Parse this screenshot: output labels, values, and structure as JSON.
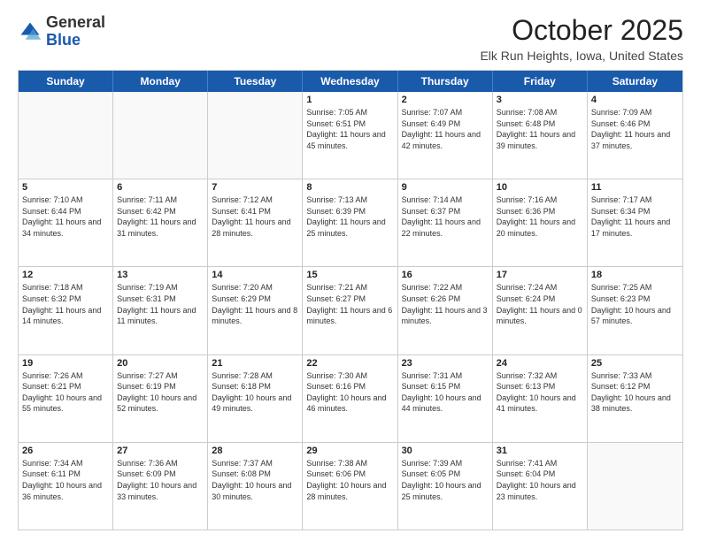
{
  "header": {
    "logo_general": "General",
    "logo_blue": "Blue",
    "month_title": "October 2025",
    "location": "Elk Run Heights, Iowa, United States"
  },
  "days_of_week": [
    "Sunday",
    "Monday",
    "Tuesday",
    "Wednesday",
    "Thursday",
    "Friday",
    "Saturday"
  ],
  "weeks": [
    [
      {
        "day": "",
        "sunrise": "",
        "sunset": "",
        "daylight": "",
        "empty": true
      },
      {
        "day": "",
        "sunrise": "",
        "sunset": "",
        "daylight": "",
        "empty": true
      },
      {
        "day": "",
        "sunrise": "",
        "sunset": "",
        "daylight": "",
        "empty": true
      },
      {
        "day": "1",
        "sunrise": "Sunrise: 7:05 AM",
        "sunset": "Sunset: 6:51 PM",
        "daylight": "Daylight: 11 hours and 45 minutes.",
        "empty": false
      },
      {
        "day": "2",
        "sunrise": "Sunrise: 7:07 AM",
        "sunset": "Sunset: 6:49 PM",
        "daylight": "Daylight: 11 hours and 42 minutes.",
        "empty": false
      },
      {
        "day": "3",
        "sunrise": "Sunrise: 7:08 AM",
        "sunset": "Sunset: 6:48 PM",
        "daylight": "Daylight: 11 hours and 39 minutes.",
        "empty": false
      },
      {
        "day": "4",
        "sunrise": "Sunrise: 7:09 AM",
        "sunset": "Sunset: 6:46 PM",
        "daylight": "Daylight: 11 hours and 37 minutes.",
        "empty": false
      }
    ],
    [
      {
        "day": "5",
        "sunrise": "Sunrise: 7:10 AM",
        "sunset": "Sunset: 6:44 PM",
        "daylight": "Daylight: 11 hours and 34 minutes.",
        "empty": false
      },
      {
        "day": "6",
        "sunrise": "Sunrise: 7:11 AM",
        "sunset": "Sunset: 6:42 PM",
        "daylight": "Daylight: 11 hours and 31 minutes.",
        "empty": false
      },
      {
        "day": "7",
        "sunrise": "Sunrise: 7:12 AM",
        "sunset": "Sunset: 6:41 PM",
        "daylight": "Daylight: 11 hours and 28 minutes.",
        "empty": false
      },
      {
        "day": "8",
        "sunrise": "Sunrise: 7:13 AM",
        "sunset": "Sunset: 6:39 PM",
        "daylight": "Daylight: 11 hours and 25 minutes.",
        "empty": false
      },
      {
        "day": "9",
        "sunrise": "Sunrise: 7:14 AM",
        "sunset": "Sunset: 6:37 PM",
        "daylight": "Daylight: 11 hours and 22 minutes.",
        "empty": false
      },
      {
        "day": "10",
        "sunrise": "Sunrise: 7:16 AM",
        "sunset": "Sunset: 6:36 PM",
        "daylight": "Daylight: 11 hours and 20 minutes.",
        "empty": false
      },
      {
        "day": "11",
        "sunrise": "Sunrise: 7:17 AM",
        "sunset": "Sunset: 6:34 PM",
        "daylight": "Daylight: 11 hours and 17 minutes.",
        "empty": false
      }
    ],
    [
      {
        "day": "12",
        "sunrise": "Sunrise: 7:18 AM",
        "sunset": "Sunset: 6:32 PM",
        "daylight": "Daylight: 11 hours and 14 minutes.",
        "empty": false
      },
      {
        "day": "13",
        "sunrise": "Sunrise: 7:19 AM",
        "sunset": "Sunset: 6:31 PM",
        "daylight": "Daylight: 11 hours and 11 minutes.",
        "empty": false
      },
      {
        "day": "14",
        "sunrise": "Sunrise: 7:20 AM",
        "sunset": "Sunset: 6:29 PM",
        "daylight": "Daylight: 11 hours and 8 minutes.",
        "empty": false
      },
      {
        "day": "15",
        "sunrise": "Sunrise: 7:21 AM",
        "sunset": "Sunset: 6:27 PM",
        "daylight": "Daylight: 11 hours and 6 minutes.",
        "empty": false
      },
      {
        "day": "16",
        "sunrise": "Sunrise: 7:22 AM",
        "sunset": "Sunset: 6:26 PM",
        "daylight": "Daylight: 11 hours and 3 minutes.",
        "empty": false
      },
      {
        "day": "17",
        "sunrise": "Sunrise: 7:24 AM",
        "sunset": "Sunset: 6:24 PM",
        "daylight": "Daylight: 11 hours and 0 minutes.",
        "empty": false
      },
      {
        "day": "18",
        "sunrise": "Sunrise: 7:25 AM",
        "sunset": "Sunset: 6:23 PM",
        "daylight": "Daylight: 10 hours and 57 minutes.",
        "empty": false
      }
    ],
    [
      {
        "day": "19",
        "sunrise": "Sunrise: 7:26 AM",
        "sunset": "Sunset: 6:21 PM",
        "daylight": "Daylight: 10 hours and 55 minutes.",
        "empty": false
      },
      {
        "day": "20",
        "sunrise": "Sunrise: 7:27 AM",
        "sunset": "Sunset: 6:19 PM",
        "daylight": "Daylight: 10 hours and 52 minutes.",
        "empty": false
      },
      {
        "day": "21",
        "sunrise": "Sunrise: 7:28 AM",
        "sunset": "Sunset: 6:18 PM",
        "daylight": "Daylight: 10 hours and 49 minutes.",
        "empty": false
      },
      {
        "day": "22",
        "sunrise": "Sunrise: 7:30 AM",
        "sunset": "Sunset: 6:16 PM",
        "daylight": "Daylight: 10 hours and 46 minutes.",
        "empty": false
      },
      {
        "day": "23",
        "sunrise": "Sunrise: 7:31 AM",
        "sunset": "Sunset: 6:15 PM",
        "daylight": "Daylight: 10 hours and 44 minutes.",
        "empty": false
      },
      {
        "day": "24",
        "sunrise": "Sunrise: 7:32 AM",
        "sunset": "Sunset: 6:13 PM",
        "daylight": "Daylight: 10 hours and 41 minutes.",
        "empty": false
      },
      {
        "day": "25",
        "sunrise": "Sunrise: 7:33 AM",
        "sunset": "Sunset: 6:12 PM",
        "daylight": "Daylight: 10 hours and 38 minutes.",
        "empty": false
      }
    ],
    [
      {
        "day": "26",
        "sunrise": "Sunrise: 7:34 AM",
        "sunset": "Sunset: 6:11 PM",
        "daylight": "Daylight: 10 hours and 36 minutes.",
        "empty": false
      },
      {
        "day": "27",
        "sunrise": "Sunrise: 7:36 AM",
        "sunset": "Sunset: 6:09 PM",
        "daylight": "Daylight: 10 hours and 33 minutes.",
        "empty": false
      },
      {
        "day": "28",
        "sunrise": "Sunrise: 7:37 AM",
        "sunset": "Sunset: 6:08 PM",
        "daylight": "Daylight: 10 hours and 30 minutes.",
        "empty": false
      },
      {
        "day": "29",
        "sunrise": "Sunrise: 7:38 AM",
        "sunset": "Sunset: 6:06 PM",
        "daylight": "Daylight: 10 hours and 28 minutes.",
        "empty": false
      },
      {
        "day": "30",
        "sunrise": "Sunrise: 7:39 AM",
        "sunset": "Sunset: 6:05 PM",
        "daylight": "Daylight: 10 hours and 25 minutes.",
        "empty": false
      },
      {
        "day": "31",
        "sunrise": "Sunrise: 7:41 AM",
        "sunset": "Sunset: 6:04 PM",
        "daylight": "Daylight: 10 hours and 23 minutes.",
        "empty": false
      },
      {
        "day": "",
        "sunrise": "",
        "sunset": "",
        "daylight": "",
        "empty": true
      }
    ]
  ]
}
